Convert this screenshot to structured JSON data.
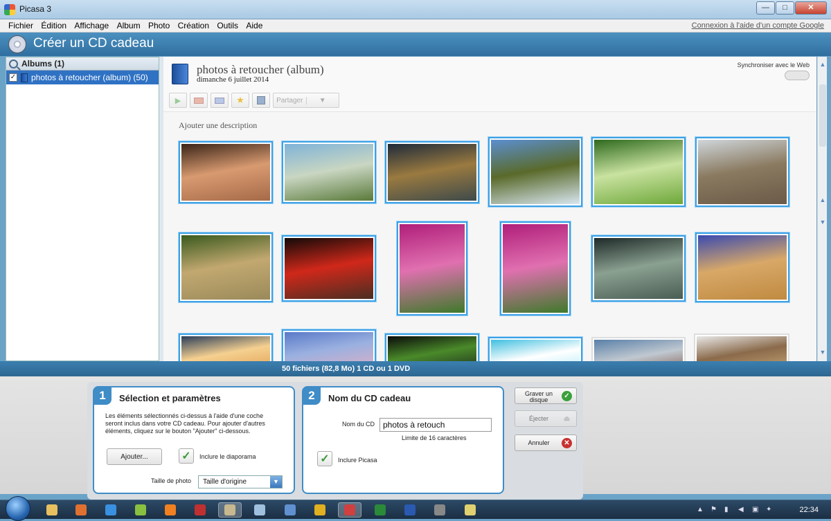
{
  "window": {
    "title": "Picasa 3",
    "buttons": {
      "minimize": "—",
      "maximize": "□",
      "close": "✕"
    }
  },
  "menu": {
    "items": [
      "Fichier",
      "Édition",
      "Affichage",
      "Album",
      "Photo",
      "Création",
      "Outils",
      "Aide"
    ],
    "google_link": "Connexion à l'aide d'un compte Google"
  },
  "mode": {
    "title": "Créer un CD cadeau"
  },
  "sidebar": {
    "header": "Albums (1)",
    "albums": [
      {
        "label": "photos à retoucher (album) (50)",
        "checked": true
      }
    ]
  },
  "album": {
    "title": "photos à retoucher (album)",
    "date": "dimanche 6 juillet 2014",
    "sync_label": "Synchroniser avec le Web",
    "share_label": "Partager",
    "description_placeholder": "Ajouter une description"
  },
  "thumbnails": [
    {
      "name": "face",
      "colors": [
        "#3a2418",
        "#a56a48",
        "#d89a70"
      ]
    },
    {
      "name": "river-valley",
      "colors": [
        "#7fb3d8",
        "#5a7a3a",
        "#c9d6c2"
      ]
    },
    {
      "name": "elephant-dusk",
      "colors": [
        "#1e2a3a",
        "#3e4a4a",
        "#9a7a40"
      ]
    },
    {
      "name": "kilimanjaro",
      "colors": [
        "#5b8fd0",
        "#d8e6f0",
        "#5a6a2a"
      ]
    },
    {
      "name": "zebras",
      "colors": [
        "#2f6a1e",
        "#6ea83a",
        "#c9e2a0"
      ]
    },
    {
      "name": "elephants-eagle",
      "colors": [
        "#cfd6db",
        "#6a5a48",
        "#8a7a60"
      ]
    },
    {
      "name": "cheetahs",
      "colors": [
        "#3a5a1e",
        "#9a8a5a",
        "#c2a870"
      ]
    },
    {
      "name": "hands-rose",
      "colors": [
        "#120a08",
        "#4a2e22",
        "#d0281a"
      ]
    },
    {
      "name": "tulips-1",
      "colors": [
        "#b01e7a",
        "#3e7a2a",
        "#e070b0"
      ]
    },
    {
      "name": "tulips-2",
      "colors": [
        "#b01e7a",
        "#3e7a2a",
        "#e070b0"
      ]
    },
    {
      "name": "marsh",
      "colors": [
        "#1e2a28",
        "#4a5e54",
        "#8aa090"
      ]
    },
    {
      "name": "lions-reflection",
      "colors": [
        "#3a4ab0",
        "#c08a40",
        "#d8a868"
      ]
    },
    {
      "name": "sunset-clouds",
      "colors": [
        "#2a3e5a",
        "#e0a050",
        "#f5d090"
      ]
    },
    {
      "name": "lake-mountains",
      "colors": [
        "#5a7ac8",
        "#d8b0c8",
        "#9ab0e0"
      ]
    },
    {
      "name": "night-grass",
      "colors": [
        "#0a0a0a",
        "#1e2a1e",
        "#4a8a2a"
      ]
    },
    {
      "name": "flower-ice",
      "colors": [
        "#40c0e0",
        "#a8e8f8",
        "#fff"
      ]
    },
    {
      "name": "woman-portrait",
      "colors": [
        "#5a80a8",
        "#7a5040",
        "#c0c8d0"
      ]
    },
    {
      "name": "cheetah-cubs",
      "colors": [
        "#e8e8e8",
        "#c8a878",
        "#8a6a4a"
      ]
    }
  ],
  "status": {
    "text": "50 fichiers (82,8 Mo) 1 CD ou 1 DVD"
  },
  "step1": {
    "number": "1",
    "title": "Sélection et paramètres",
    "text": "Les éléments sélectionnés ci-dessus à l'aide d'une coche seront inclus dans votre CD cadeau. Pour ajouter d'autres éléments, cliquez sur le bouton \"Ajouter\" ci-dessous.",
    "add_button": "Ajouter...",
    "slideshow_label": "Inclure le diaporama",
    "photo_size_label": "Taille de photo",
    "photo_size_value": "Taille d'origine"
  },
  "step2": {
    "number": "2",
    "title": "Nom du CD cadeau",
    "name_label": "Nom du CD",
    "name_value": "photos à retouch",
    "limit_text": "Limite de 16 caractères",
    "include_picasa_label": "Inclure Picasa"
  },
  "actions": {
    "burn": "Graver un disque",
    "eject": "Éjecter",
    "cancel": "Annuler"
  },
  "taskbar": {
    "clock": "22:34",
    "apps": [
      {
        "name": "explorer",
        "color": "#e8c060"
      },
      {
        "name": "firefox",
        "color": "#e07030"
      },
      {
        "name": "internet-explorer",
        "color": "#3a90e0"
      },
      {
        "name": "app-4",
        "color": "#8ac040"
      },
      {
        "name": "media",
        "color": "#f08020"
      },
      {
        "name": "app-6",
        "color": "#c03030"
      },
      {
        "name": "app-7",
        "color": "#c8b890"
      },
      {
        "name": "notepad",
        "color": "#a0c0e0"
      },
      {
        "name": "app-9",
        "color": "#6090d0"
      },
      {
        "name": "chrome",
        "color": "#e0b020"
      },
      {
        "name": "picasa",
        "color": "#d04040"
      },
      {
        "name": "excel",
        "color": "#2a8a3a"
      },
      {
        "name": "word",
        "color": "#2a5ab0"
      },
      {
        "name": "app-14",
        "color": "#888"
      },
      {
        "name": "app-15",
        "color": "#e0d070"
      }
    ]
  }
}
